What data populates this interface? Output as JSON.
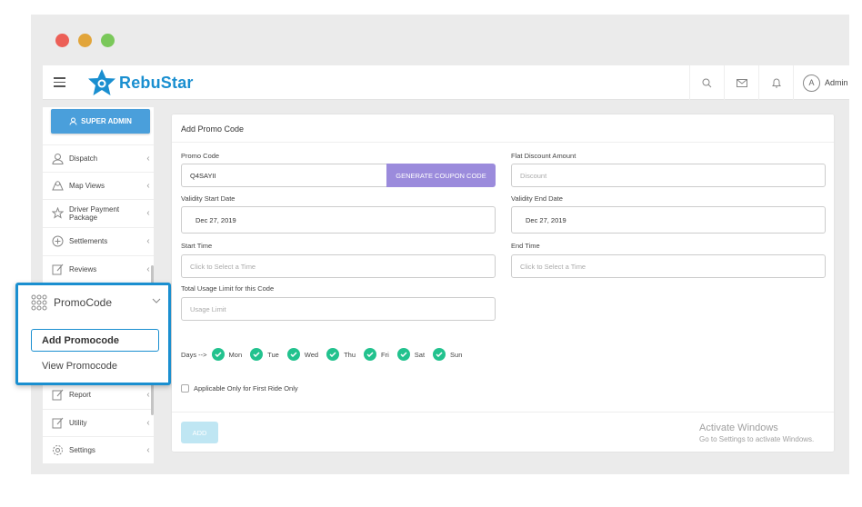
{
  "window": {
    "dots": [
      "#ec5f57",
      "#e2a53a",
      "#7ac85a"
    ]
  },
  "header": {
    "logo_text": "RebuStar",
    "admin_initial": "A",
    "admin_label": "Admin",
    "icons": [
      "menu-icon",
      "search-icon",
      "mail-icon",
      "bell-icon"
    ]
  },
  "sidebar": {
    "super_admin_label": "SUPER ADMIN",
    "items": [
      {
        "label": "Dispatch",
        "icon": "user-icon"
      },
      {
        "label": "Map Views",
        "icon": "map-icon"
      },
      {
        "label": "Driver Payment Package",
        "icon": "star-icon"
      },
      {
        "label": "Settlements",
        "icon": "plus-circle-icon"
      },
      {
        "label": "Reviews",
        "icon": "edit-icon"
      },
      {
        "label": "Report",
        "icon": "edit-icon"
      },
      {
        "label": "Utility",
        "icon": "edit-icon"
      },
      {
        "label": "Settings",
        "icon": "gear-icon"
      }
    ],
    "promocode": {
      "title": "PromoCode",
      "add_label": "Add Promocode",
      "view_label": "View Promocode"
    }
  },
  "form": {
    "title": "Add Promo Code",
    "promo_code_label": "Promo Code",
    "promo_code_value": "Q4SAYII",
    "generate_label": "GENERATE COUPON CODE",
    "flat_discount_label": "Flat Discount Amount",
    "flat_discount_placeholder": "Discount",
    "validity_start_label": "Validity Start Date",
    "validity_start_value": "Dec 27, 2019",
    "validity_end_label": "Validity End Date",
    "validity_end_value": "Dec 27, 2019",
    "start_time_label": "Start Time",
    "start_time_placeholder": "Click to Select a Time",
    "end_time_label": "End Time",
    "end_time_placeholder": "Click to Select a Time",
    "usage_limit_label": "Total Usage Limit for this Code",
    "usage_limit_placeholder": "Usage Limit",
    "days_label": "Days -->",
    "days": [
      "Mon",
      "Tue",
      "Wed",
      "Thu",
      "Fri",
      "Sat",
      "Sun"
    ],
    "first_ride_label": "Applicable Only for First Ride Only",
    "add_label": "ADD"
  },
  "watermark": {
    "line1": "Activate Windows",
    "line2": "Go to Settings to activate Windows."
  },
  "colors": {
    "accent": "#1a8fd0",
    "super_admin": "#4a9fdb",
    "generate": "#9b8bdc",
    "check": "#22c28e",
    "add_button": "#bfe6f3"
  }
}
